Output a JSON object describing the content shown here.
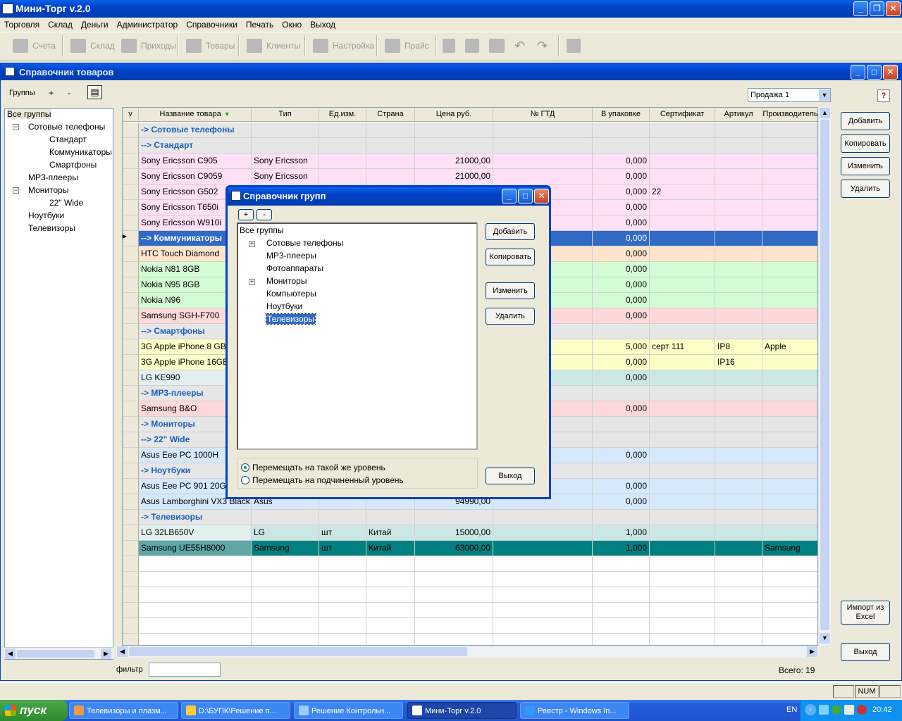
{
  "app": {
    "title": "Мини-Торг v.2.0"
  },
  "menu": [
    "Торговля",
    "Склад",
    "Деньги",
    "Администратор",
    "Справочники",
    "Печать",
    "Окно",
    "Выход"
  ],
  "toolbar": {
    "items": [
      "Счета",
      "Склад",
      "Приходы",
      "Товары",
      "Клиенты",
      "Настройка",
      "Прайс"
    ]
  },
  "child": {
    "title": "Справочник товаров",
    "groups_label": "Группы",
    "plus": "+",
    "minus": "-",
    "sale_select": "Продажа 1",
    "help": "?",
    "tree": [
      "Все группы",
      "Сотовые телефоны",
      "Стандарт",
      "Коммуникаторы",
      "Смартфоны",
      "MP3-плееры",
      "Мониторы",
      "22\" Wide",
      "Ноутбуки",
      "Телевизоры"
    ],
    "columns": [
      "v",
      "Название товара",
      "Тип",
      "Ед.изм.",
      "Страна",
      "Цена руб.",
      "№ ГТД",
      "В упаковке",
      "Сертификат",
      "Артикул",
      "Производитель"
    ],
    "rows": [
      {
        "name": "-> Сотовые телефоны",
        "group": true
      },
      {
        "name": "--> Стандарт",
        "group": true
      },
      {
        "name": "Sony Ericsson C905",
        "type": "Sony Ericsson",
        "price": "21000,00",
        "pack": "0,000",
        "color": "#ffe0f7"
      },
      {
        "name": "Sony Ericsson C9059",
        "type": "Sony Ericsson",
        "price": "21000,00",
        "pack": "0,000",
        "color": "#ffe0f7"
      },
      {
        "name": "Sony Ericsson G502",
        "pack": "0,000",
        "cert": "22",
        "color": "#ffe0f7"
      },
      {
        "name": "Sony Ericsson T650i",
        "pack": "0,000",
        "color": "#ffe0f7"
      },
      {
        "name": "Sony Ericsson W910i",
        "pack": "0,000",
        "color": "#ffe0f7"
      },
      {
        "name": "--> Коммуникаторы",
        "group": true,
        "pack": "0,000",
        "selected": true
      },
      {
        "name": "HTC Touch Diamond",
        "pack": "0,000",
        "color": "#ffe4cc"
      },
      {
        "name": "Nokia N81 8GB",
        "pack": "0,000",
        "color": "#d4fcd4"
      },
      {
        "name": "Nokia N95 8GB",
        "pack": "0,000",
        "color": "#d4fcd4"
      },
      {
        "name": "Nokia N96",
        "pack": "0,000",
        "color": "#d4fcd4"
      },
      {
        "name": "Samsung SGH-F700",
        "pack": "0,000",
        "color": "#fcd8d8"
      },
      {
        "name": "--> Смартфоны",
        "group": true
      },
      {
        "name": "3G Apple iPhone  8 GB",
        "pack": "5,000",
        "cert": "серт 111",
        "art": "IP8",
        "maker": "Apple",
        "color": "#fdfdc8"
      },
      {
        "name": "3G Apple iPhone 16GB",
        "pack": "0,000",
        "art": "IP16",
        "color": "#fdfdc8"
      },
      {
        "name": "LG KE990",
        "pack": "0,000",
        "color": "#cce6e6"
      },
      {
        "name": "-> MP3-плееры",
        "group": true
      },
      {
        "name": "Samsung B&O",
        "pack": "0,000",
        "color": "#fcd8d8"
      },
      {
        "name": "-> Мониторы",
        "group": true
      },
      {
        "name": "--> 22\" Wide",
        "group": true
      },
      {
        "name": "Asus Eee PC 1000H",
        "pack": "0,000",
        "color": "#d6e8fb"
      },
      {
        "name": "-> Ноутбуки",
        "group": true
      },
      {
        "name": "Asus Eee PC 901 20G",
        "pack": "0,000",
        "color": "#d6e8fb"
      },
      {
        "name": "Asus Lamborghini VX3 Black",
        "type": "Asus",
        "price": "94990,00",
        "pack": "0,000",
        "color": "#d6e8fb"
      },
      {
        "name": "-> Телевизоры",
        "group": true
      },
      {
        "name": "LG 32LB650V",
        "type": "LG",
        "unit": "шт",
        "country": "Китай",
        "price": "15000,00",
        "pack": "1,000",
        "color": "#cce6e6"
      },
      {
        "name": "Samsung UE55H8000",
        "type": "Samsung",
        "unit": "шт",
        "country": "Китай",
        "price": "63000,00",
        "pack": "1,000",
        "maker": "Samsung",
        "color": "#008080",
        "dark": true
      }
    ],
    "buttons": {
      "add": "Добавить",
      "copy": "Копировать",
      "edit": "Изменить",
      "del": "Удалить",
      "import": "Импорт из Excel",
      "exit": "Выход"
    },
    "filter_label": "фильтр",
    "filter_value": "",
    "total": "Всего: 19"
  },
  "dialog": {
    "title": "Справочник групп",
    "plus": "+",
    "minus": "-",
    "tree": [
      "Все группы",
      "Сотовые телефоны",
      "MP3-плееры",
      "Фотоаппараты",
      "Мониторы",
      "Компьютеры",
      "Ноутбуки",
      "Телевизоры"
    ],
    "buttons": {
      "add": "Добавить",
      "copy": "Копировать",
      "edit": "Изменить",
      "del": "Удалить",
      "exit": "Выход"
    },
    "radio": [
      "Перемещать на такой же уровень",
      "Перемещать на подчиненный уровень"
    ]
  },
  "status": {
    "num": "NUM"
  },
  "taskbar": {
    "start": "пуск",
    "tasks": [
      "Телевизоры и плазм...",
      "D:\\БУПК\\Решение п...",
      "Решение Контрольн...",
      "Мини-Торг v.2.0",
      "Реестр - Windows In..."
    ],
    "lang": "EN",
    "time": "20:42"
  }
}
